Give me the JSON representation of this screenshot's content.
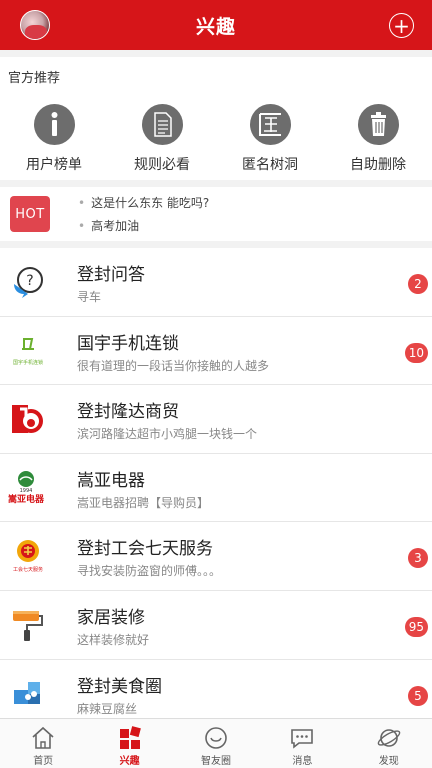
{
  "header": {
    "title": "兴趣",
    "add_icon": "plus-circle-icon"
  },
  "official": {
    "label": "官方推荐",
    "entries": [
      {
        "label": "用户榜单",
        "icon": "info-icon"
      },
      {
        "label": "规则必看",
        "icon": "document-icon"
      },
      {
        "label": "匿名树洞",
        "icon": "anonymous-icon"
      },
      {
        "label": "自助删除",
        "icon": "trash-icon"
      }
    ]
  },
  "hot": {
    "badge": "HOT",
    "lines": [
      "这是什么东东  能吃吗?",
      "高考加油"
    ]
  },
  "groups": [
    {
      "title": "登封问答",
      "subtitle": "寻车",
      "count": "2",
      "icon": "question-bubble-icon"
    },
    {
      "title": "国宇手机连锁",
      "subtitle": "很有道理的一段话当你接触的人越多",
      "count": "10",
      "icon": "guoyu-logo",
      "logo_text": "国宇手机连锁"
    },
    {
      "title": "登封隆达商贸",
      "subtitle": "滨河路隆达超市小鸡腿一块钱一个",
      "count": "",
      "icon": "longda-logo"
    },
    {
      "title": "嵩亚电器",
      "subtitle": "嵩亚电器招聘【导购员】",
      "count": "",
      "icon": "songya-logo",
      "logo_text": "嵩亚电器",
      "logo_year": "1994"
    },
    {
      "title": "登封工会七天服务",
      "subtitle": "寻找安装防盗窗的师傅。。。",
      "count": "3",
      "icon": "union-logo",
      "logo_text": "工会七天服务"
    },
    {
      "title": "家居装修",
      "subtitle": "这样装修就好",
      "count": "95",
      "icon": "paint-roller-icon"
    },
    {
      "title": "登封美食圈",
      "subtitle": "麻辣豆腐丝",
      "count": "5",
      "icon": "puzzle-icon"
    }
  ],
  "tabbar": [
    {
      "label": "首页",
      "icon": "home-icon",
      "active": false
    },
    {
      "label": "兴趣",
      "icon": "interest-icon",
      "active": true
    },
    {
      "label": "智友圈",
      "icon": "smile-icon",
      "active": false
    },
    {
      "label": "消息",
      "icon": "message-icon",
      "active": false
    },
    {
      "label": "发现",
      "icon": "planet-icon",
      "active": false
    }
  ],
  "colors": {
    "brand": "#d61519",
    "badge": "#e64545",
    "hot": "#e0454e",
    "icon_gray": "#6d6d6d"
  }
}
